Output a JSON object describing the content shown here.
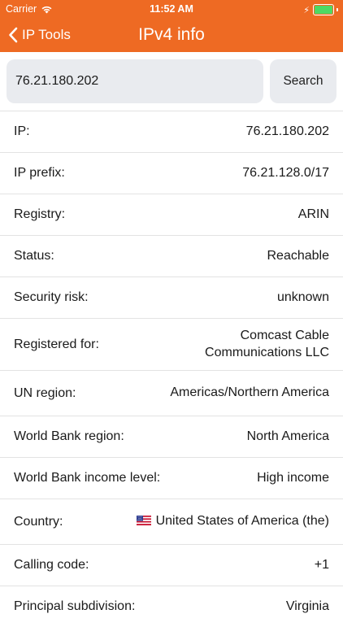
{
  "status_bar": {
    "carrier": "Carrier",
    "time": "11:52 AM",
    "battery_level_percent": 100
  },
  "nav": {
    "back_label": "IP Tools",
    "title": "IPv4 info"
  },
  "search": {
    "value": "76.21.180.202",
    "button_label": "Search"
  },
  "rows": [
    {
      "label": "IP:",
      "value": "76.21.180.202"
    },
    {
      "label": "IP prefix:",
      "value": "76.21.128.0/17"
    },
    {
      "label": "Registry:",
      "value": "ARIN"
    },
    {
      "label": "Status:",
      "value": "Reachable"
    },
    {
      "label": "Security risk:",
      "value": "unknown"
    },
    {
      "label": "Registered for:",
      "value": "Comcast Cable Communications LLC"
    },
    {
      "label": "UN region:",
      "value": "Americas/Northern America"
    },
    {
      "label": "World Bank region:",
      "value": "North America"
    },
    {
      "label": "World Bank income level:",
      "value": "High income"
    },
    {
      "label": "Country:",
      "value": "United States of America (the)",
      "icon": "us-flag-icon"
    },
    {
      "label": "Calling code:",
      "value": "+1"
    },
    {
      "label": "Principal subdivision:",
      "value": "Virginia"
    }
  ],
  "colors": {
    "header": "#ee6a23",
    "battery": "#4cd964",
    "field_bg": "#e9ebef"
  }
}
